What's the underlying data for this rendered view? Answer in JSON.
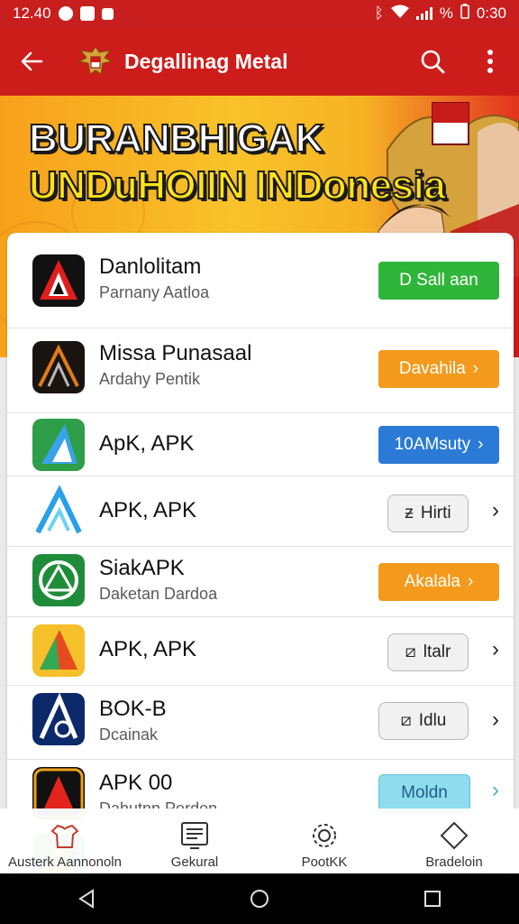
{
  "status_bar": {
    "time_left": "12.40",
    "battery_pct": "%",
    "time_right": "0:30"
  },
  "app_bar": {
    "title": "Degallinag Metal",
    "back_icon": "back-arrow-icon",
    "search_icon": "search-icon",
    "more_icon": "more-vert-icon"
  },
  "banner": {
    "line1": "BURANBHIGAK",
    "line2": "UNDuHOIIN INDonesia"
  },
  "apps": [
    {
      "name": "Danlolitam",
      "subtitle": "Parnany Aatloa",
      "action": "D Sall aan",
      "action_style": "green"
    },
    {
      "name": "Missa Punasaal",
      "subtitle": "Ardahy Pentik",
      "action": "Davahila",
      "action_style": "orange"
    },
    {
      "name": "ApK, APK",
      "subtitle": "",
      "action": "10AMsuty",
      "action_style": "blue"
    },
    {
      "name": "APK, APK",
      "subtitle": "",
      "action": "Hirti",
      "action_style": "outline"
    },
    {
      "name": "SiakAPK",
      "subtitle": "Daketan Dardoa",
      "action": "Akalala",
      "action_style": "orange"
    },
    {
      "name": "APK, APK",
      "subtitle": "",
      "action": "ltalr",
      "action_style": "outline"
    },
    {
      "name": "BOK-B",
      "subtitle": "Dcainak",
      "action": "Idlu",
      "action_style": "outline"
    },
    {
      "name": "APK 00",
      "subtitle": "Dahutnn Perden",
      "action": "Moldn",
      "action_style": "lightblue"
    }
  ],
  "bottom_nav": [
    {
      "label": "Austerk Aannonoln",
      "icon": "shirt-icon"
    },
    {
      "label": "Gekural",
      "icon": "monitor-icon"
    },
    {
      "label": "PootKK",
      "icon": "settings-gear-icon"
    },
    {
      "label": "Bradeloin",
      "icon": "diamond-icon"
    }
  ],
  "colors": {
    "primary": "#cc1d1a",
    "green": "#2fb53a",
    "orange": "#f39a1c",
    "blue": "#2b7bd6"
  }
}
